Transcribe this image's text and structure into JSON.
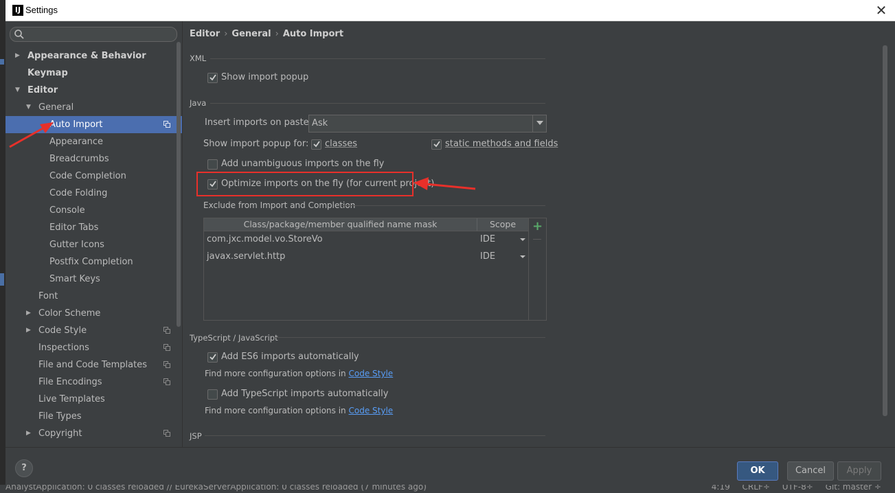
{
  "window": {
    "title": "Settings",
    "close_glyph": "✕"
  },
  "search": {
    "placeholder": ""
  },
  "sidebar": {
    "items": [
      {
        "label": "Appearance & Behavior"
      },
      {
        "label": "Keymap"
      },
      {
        "label": "Editor"
      },
      {
        "label": "General"
      },
      {
        "label": "Auto Import"
      },
      {
        "label": "Appearance"
      },
      {
        "label": "Breadcrumbs"
      },
      {
        "label": "Code Completion"
      },
      {
        "label": "Code Folding"
      },
      {
        "label": "Console"
      },
      {
        "label": "Editor Tabs"
      },
      {
        "label": "Gutter Icons"
      },
      {
        "label": "Postfix Completion"
      },
      {
        "label": "Smart Keys"
      },
      {
        "label": "Font"
      },
      {
        "label": "Color Scheme"
      },
      {
        "label": "Code Style"
      },
      {
        "label": "Inspections"
      },
      {
        "label": "File and Code Templates"
      },
      {
        "label": "File Encodings"
      },
      {
        "label": "Live Templates"
      },
      {
        "label": "File Types"
      },
      {
        "label": "Copyright"
      }
    ],
    "selected": "Auto Import"
  },
  "breadcrumb": {
    "part1": "Editor",
    "part2": "General",
    "part3": "Auto Import",
    "sep": "›"
  },
  "xml": {
    "section_label": "XML",
    "show_import_popup": {
      "label": "Show import popup",
      "checked": true
    }
  },
  "java": {
    "section_label": "Java",
    "insert_imports_label": "Insert imports on paste:",
    "insert_imports_value": "Ask",
    "show_popup_for_label": "Show import popup for:",
    "classes": {
      "label": "classes",
      "checked": true
    },
    "static_methods": {
      "label": "static methods and fields",
      "checked": true
    },
    "add_unambiguous": {
      "label": "Add unambiguous imports on the fly",
      "checked": false
    },
    "optimize_imports": {
      "label": "Optimize imports on the fly (for current project)",
      "checked": true
    },
    "exclude_label": "Exclude from Import and Completion",
    "table": {
      "col1": "Class/package/member qualified name mask",
      "col2": "Scope",
      "rows": [
        {
          "mask": "com.jxc.model.vo.StoreVo",
          "scope": "IDE"
        },
        {
          "mask": "javax.servlet.http",
          "scope": "IDE"
        }
      ],
      "add_glyph": "+"
    }
  },
  "typescript": {
    "section_label": "TypeScript / JavaScript",
    "es6": {
      "label": "Add ES6 imports automatically",
      "checked": true
    },
    "find_more_1": "Find more configuration options in",
    "link_1": "Code Style",
    "ts": {
      "label": "Add TypeScript imports automatically",
      "checked": false
    },
    "find_more_2": "Find more configuration options in",
    "link_2": "Code Style"
  },
  "jsp": {
    "section_label": "JSP"
  },
  "buttons": {
    "ok": "OK",
    "cancel": "Cancel",
    "apply": "Apply",
    "help": "?"
  },
  "statusbar": {
    "message": "AnalystApplication: 0 classes reloaded // EurekaServerApplication: 0 classes reloaded (7 minutes ago)",
    "position": "4:19",
    "line_sep": "CRLF÷",
    "encoding": "UTF-8÷",
    "git": "Git: master ÷"
  },
  "colors": {
    "background": "#3c3f41",
    "selection": "#4b6eaf",
    "link": "#589df6",
    "annotation_red": "#e8302a",
    "add_green": "#59a869"
  }
}
